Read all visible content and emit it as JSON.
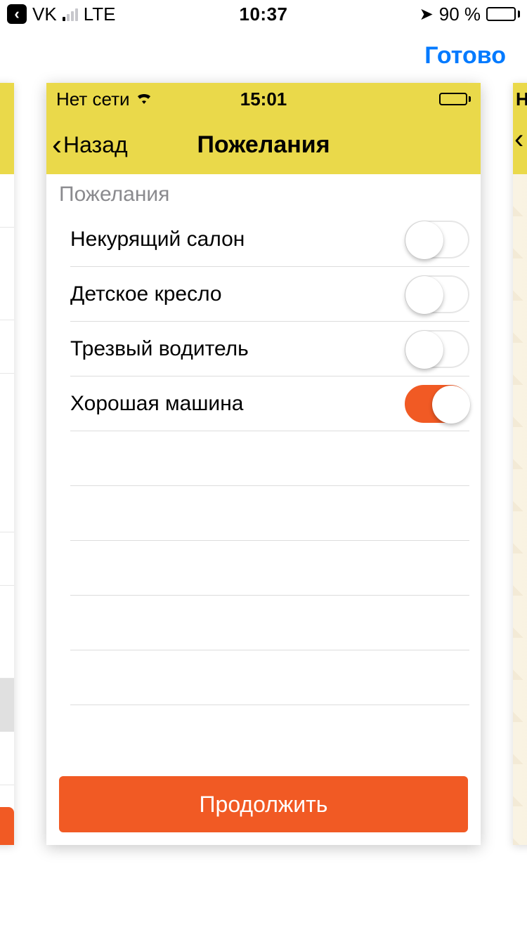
{
  "outer_status": {
    "back_app": "VK",
    "carrier": "LTE",
    "time": "10:37",
    "battery_pct": "90 %"
  },
  "outer_nav": {
    "done": "Готово"
  },
  "inner_status": {
    "carrier": "Нет сети",
    "time": "15:01"
  },
  "inner_nav": {
    "back": "Назад",
    "title": "Пожелания"
  },
  "section": {
    "label": "Пожелания"
  },
  "options": [
    {
      "label": "Некурящий салон",
      "on": false
    },
    {
      "label": "Детское кресло",
      "on": false
    },
    {
      "label": "Трезвый водитель",
      "on": false
    },
    {
      "label": "Хорошая машина",
      "on": true
    }
  ],
  "continue_label": "Продолжить",
  "colors": {
    "accent_orange": "#f15a24",
    "header_yellow": "#ead94a",
    "ios_blue": "#007aff"
  }
}
